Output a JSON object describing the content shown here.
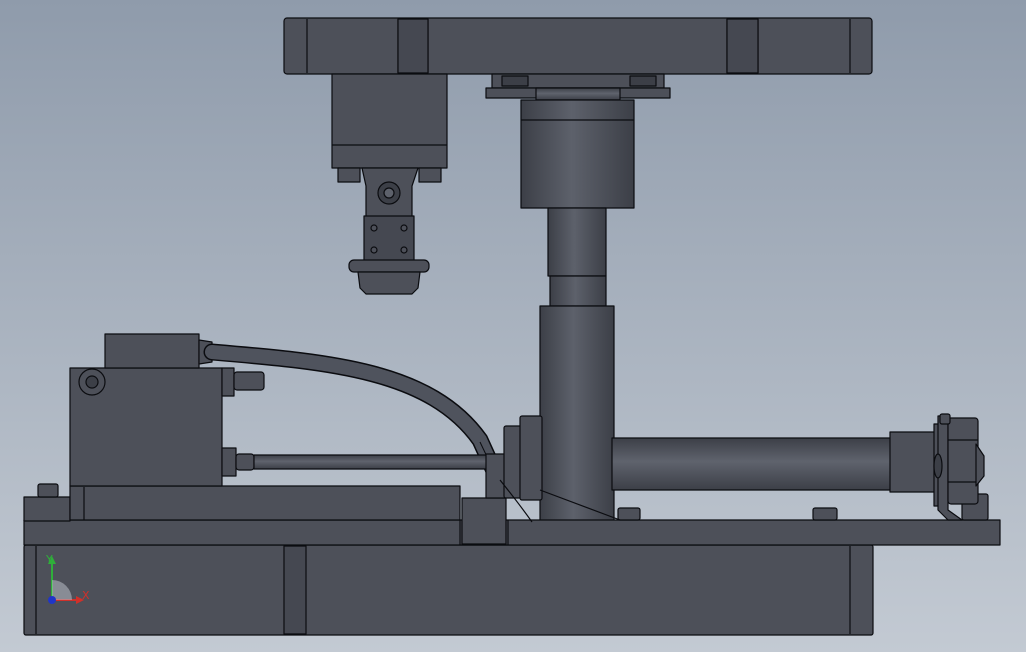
{
  "colors": {
    "background_top": "#8f9bab",
    "background_bottom": "#c3cad3",
    "part_fill": "#4d5059",
    "part_fill_light": "#5d616b",
    "part_fill_dark": "#3c3f47",
    "edge": "#0b0c10",
    "axis_x": "#d0302a",
    "axis_y": "#2fae3a",
    "axis_z": "#2035c8"
  },
  "triad": {
    "x_label": "X",
    "y_label": "Y"
  }
}
